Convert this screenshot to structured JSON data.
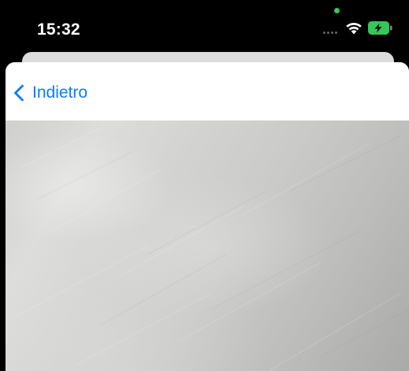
{
  "status_bar": {
    "time": "15:32",
    "camera_indicator_color": "#34c759",
    "icons": [
      "cellular-dots-icon",
      "wifi-icon",
      "battery-charging-icon"
    ],
    "battery_color": "#34c759"
  },
  "nav": {
    "back_label": "Indietro",
    "back_icon": "chevron-left-icon",
    "accent_color": "#0a7aff"
  },
  "camera_view": {
    "description_icon": "camera-preview"
  }
}
